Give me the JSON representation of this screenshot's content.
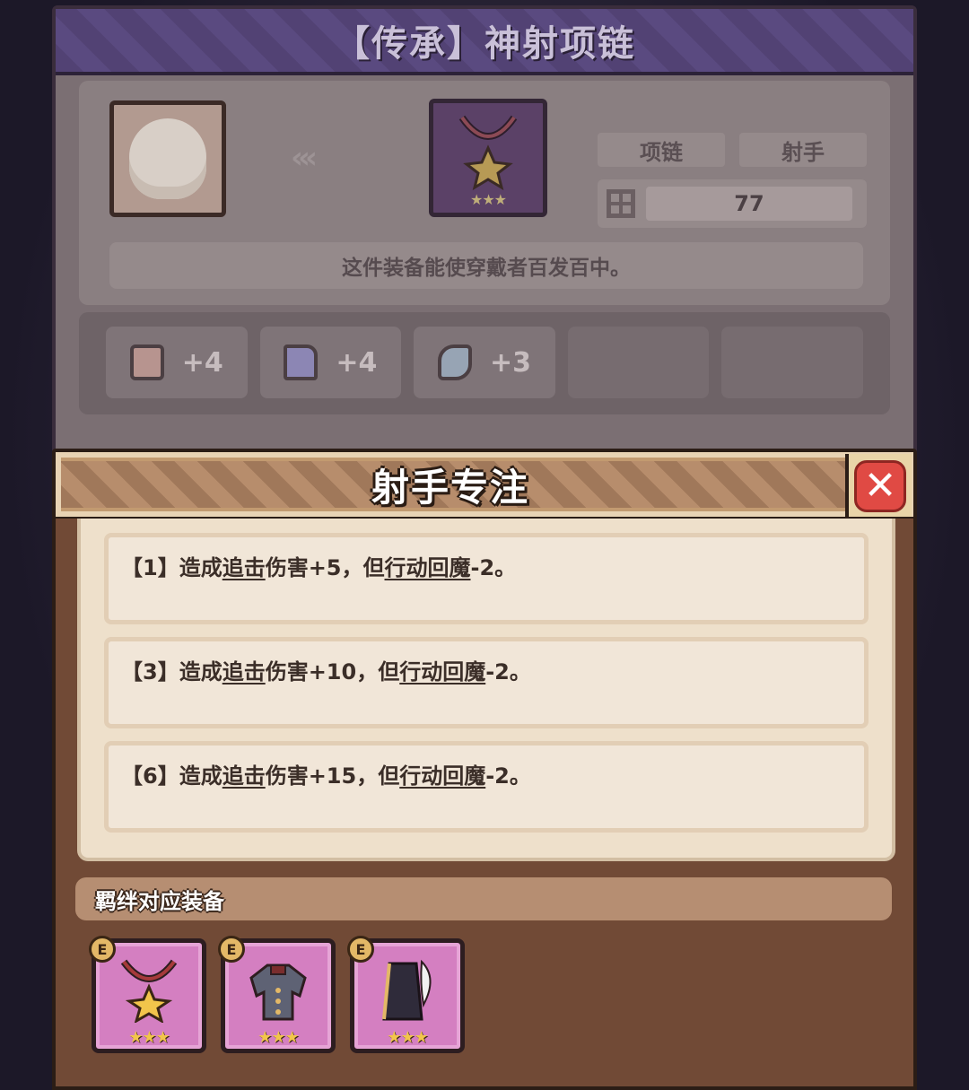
{
  "item_panel": {
    "title": "【传承】神射项链",
    "tags": [
      "项链",
      "射手"
    ],
    "level_value": "77",
    "description": "这件装备能使穿戴者百发百中。",
    "item_stars": "★★★",
    "stats": [
      {
        "icon": "shield-icon",
        "value": "+4"
      },
      {
        "icon": "boot-icon",
        "value": "+4"
      },
      {
        "icon": "feather-icon",
        "value": "+3"
      }
    ]
  },
  "dialog": {
    "title": "射手专注",
    "close_label": "✕",
    "effects": [
      {
        "prefix": "【1】造成",
        "term1": "追击",
        "mid": "伤害+5，但",
        "term2": "行动回魔",
        "suffix": "-2。"
      },
      {
        "prefix": "【3】造成",
        "term1": "追击",
        "mid": "伤害+10，但",
        "term2": "行动回魔",
        "suffix": "-2。"
      },
      {
        "prefix": "【6】造成",
        "term1": "追击",
        "mid": "伤害+15，但",
        "term2": "行动回魔",
        "suffix": "-2。"
      }
    ],
    "bond_title": "羁绊对应装备",
    "bond_items": [
      {
        "name": "necklace-icon",
        "badge": "E",
        "stars": "★★★"
      },
      {
        "name": "armor-icon",
        "badge": "E",
        "stars": "★★★"
      },
      {
        "name": "cloak-icon",
        "badge": "E",
        "stars": "★★★"
      }
    ]
  },
  "colors": {
    "dialog_body": "#714a36",
    "effects_bg": "#eee0cb",
    "close_red": "#e04a44",
    "bond_item_bg": "#d47fc1"
  }
}
